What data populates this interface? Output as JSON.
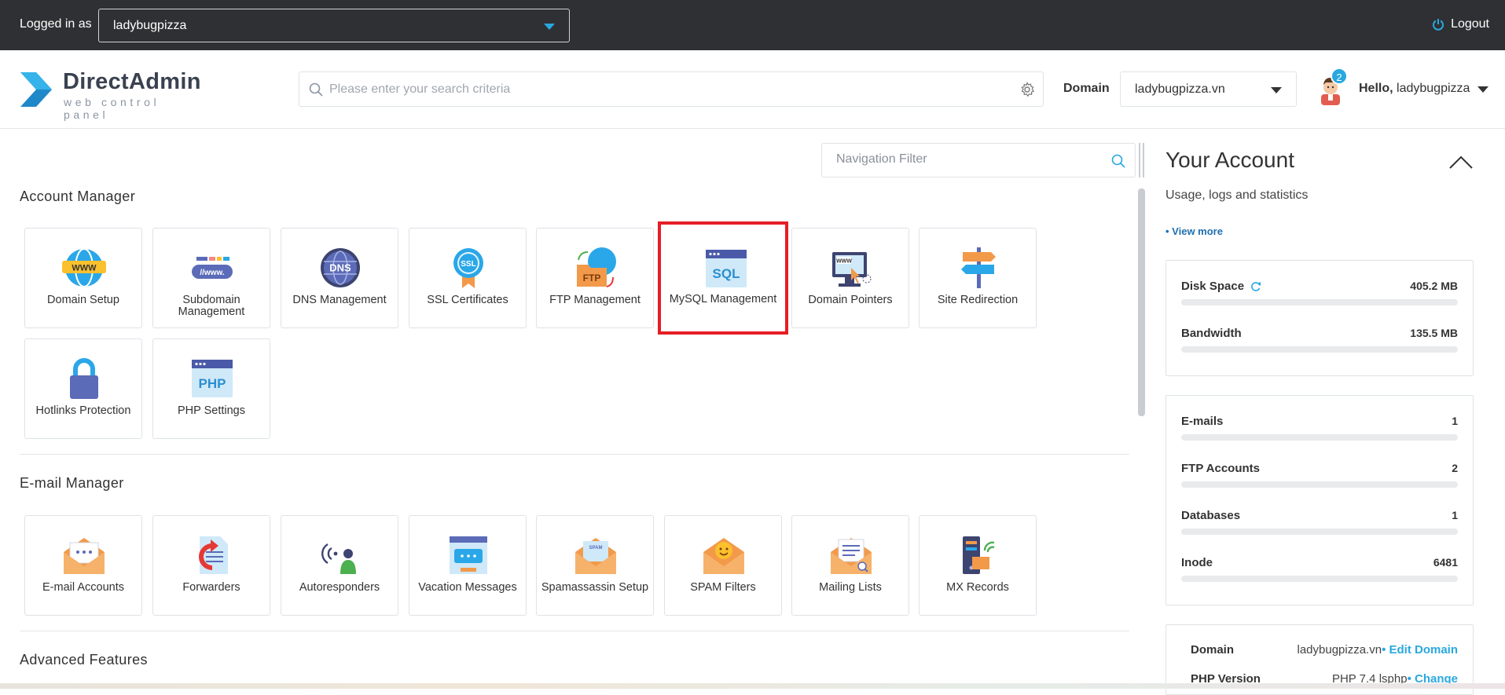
{
  "topbar": {
    "login_label": "Logged in as",
    "user_value": "ladybugpizza",
    "logout_label": "Logout"
  },
  "header": {
    "logo_name": "DirectAdmin",
    "logo_tagline": "web control panel",
    "search_placeholder": "Please enter your search criteria",
    "domain_label": "Domain",
    "domain_value": "ladybugpizza.vn",
    "notification_count": "2",
    "hello_prefix": "Hello,",
    "hello_user": "ladybugpizza"
  },
  "main": {
    "nav_filter_placeholder": "Navigation Filter",
    "sections": [
      {
        "title": "Account Manager",
        "items": [
          {
            "label": "Domain Setup",
            "icon": "globe-www-icon"
          },
          {
            "label": "Subdomain Management",
            "icon": "subdomain-icon"
          },
          {
            "label": "DNS Management",
            "icon": "dns-globe-icon"
          },
          {
            "label": "SSL Certificates",
            "icon": "ssl-badge-icon"
          },
          {
            "label": "FTP Management",
            "icon": "ftp-folder-icon"
          },
          {
            "label": "MySQL Management",
            "icon": "sql-window-icon",
            "selected": true
          },
          {
            "label": "Domain Pointers",
            "icon": "monitor-www-icon"
          },
          {
            "label": "Site Redirection",
            "icon": "signpost-icon"
          },
          {
            "label": "Hotlinks Protection",
            "icon": "padlock-icon"
          },
          {
            "label": "PHP Settings",
            "icon": "php-window-icon"
          }
        ]
      },
      {
        "title": "E-mail Manager",
        "items": [
          {
            "label": "E-mail Accounts",
            "icon": "envelope-icon"
          },
          {
            "label": "Forwarders",
            "icon": "forward-document-icon"
          },
          {
            "label": "Autoresponders",
            "icon": "autoresponder-person-icon"
          },
          {
            "label": "Vacation Messages",
            "icon": "vacation-chat-icon"
          },
          {
            "label": "Spamassassin Setup",
            "icon": "spam-envelope-icon"
          },
          {
            "label": "SPAM Filters",
            "icon": "smiley-envelope-icon"
          },
          {
            "label": "Mailing Lists",
            "icon": "mailing-list-envelope-icon"
          },
          {
            "label": "MX Records",
            "icon": "mx-server-icon"
          }
        ]
      },
      {
        "title": "Advanced Features",
        "items": []
      }
    ]
  },
  "panel": {
    "title": "Your Account",
    "subtitle": "Usage, logs and statistics",
    "view_more": "• View more",
    "usage": [
      {
        "name": "Disk Space",
        "value": "405.2 MB",
        "fill": 0
      },
      {
        "name": "Bandwidth",
        "value": "135.5 MB",
        "fill": 0
      }
    ],
    "counts": [
      {
        "name": "E-mails",
        "value": "1",
        "fill": 0
      },
      {
        "name": "FTP Accounts",
        "value": "2",
        "fill": 0
      },
      {
        "name": "Databases",
        "value": "1",
        "fill": 0
      },
      {
        "name": "Inode",
        "value": "6481",
        "fill": 0
      }
    ],
    "info": {
      "domain_key": "Domain",
      "domain_value": "ladybugpizza.vn",
      "domain_action": "• Edit Domain",
      "php_key": "PHP Version",
      "php_value": "PHP 7.4 lsphp",
      "php_action": "• Change"
    }
  },
  "colors": {
    "topbar_bg": "#2f3033",
    "accent": "#29a8e0",
    "selection_outline": "#e41e26"
  }
}
